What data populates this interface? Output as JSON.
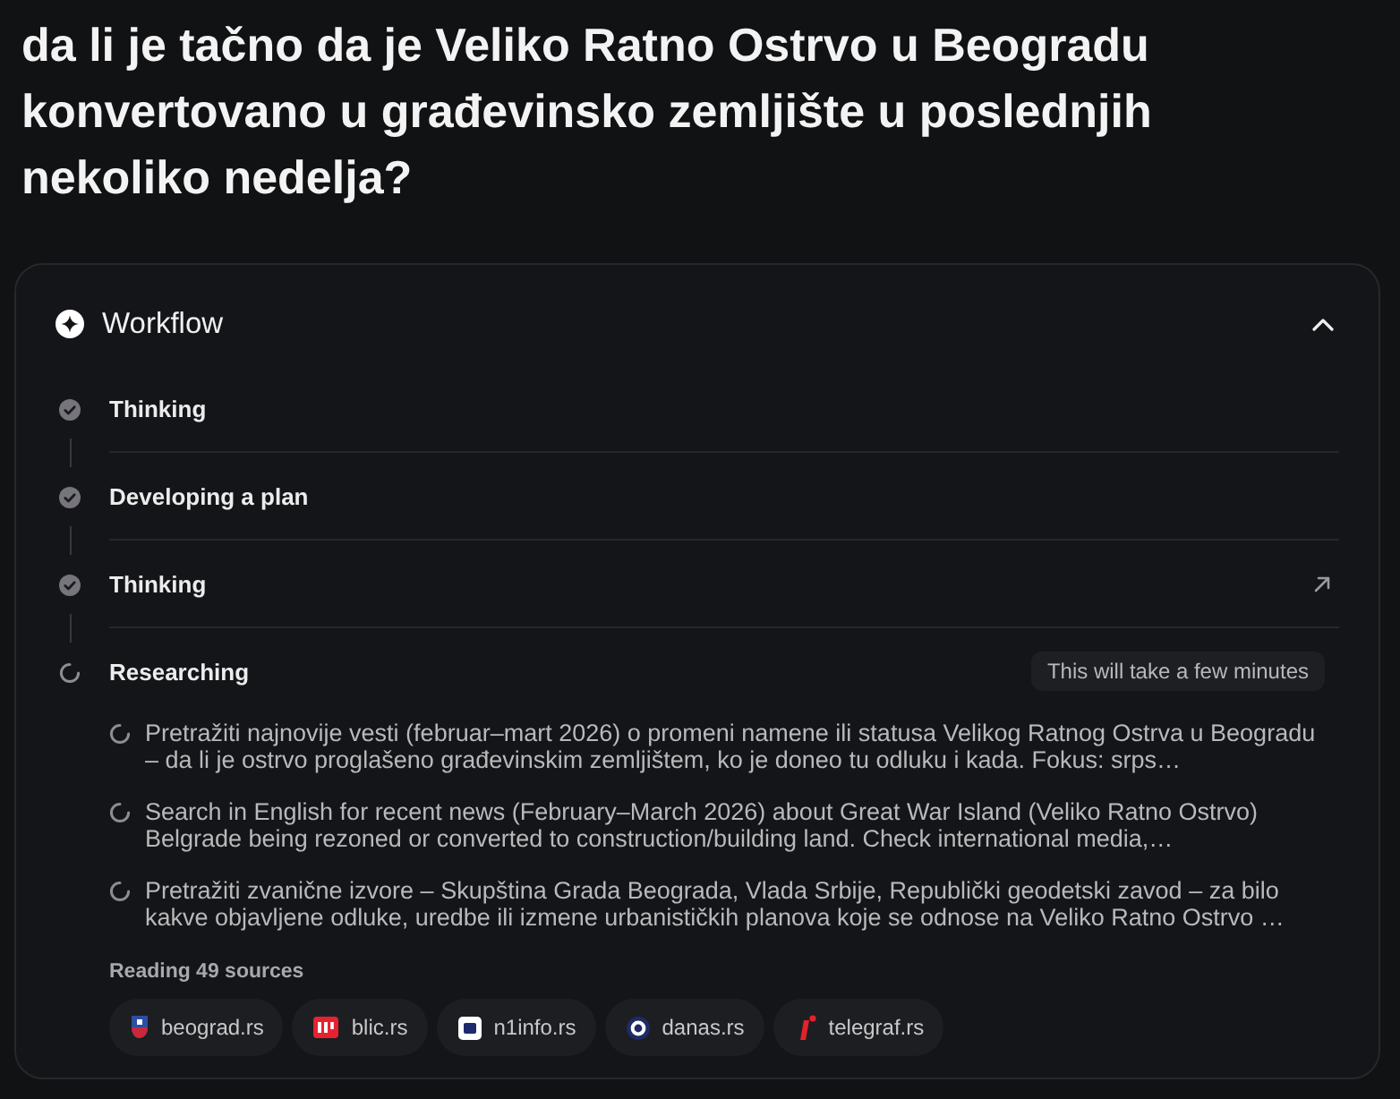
{
  "question": "da li je tačno da je Veliko Ratno Ostrvo u Beogradu konvertovano u građevinsko zemljište u poslednjih nekoliko nedelja?",
  "workflow": {
    "title": "Workflow",
    "expanded": true,
    "steps": [
      {
        "label": "Thinking",
        "done": true,
        "link": false
      },
      {
        "label": "Developing a plan",
        "done": true,
        "link": false
      },
      {
        "label": "Thinking",
        "done": true,
        "link": true
      },
      {
        "label": "Researching",
        "done": false,
        "link": false,
        "note": "This will take a few minutes",
        "tasks": [
          {
            "text": "Pretražiti najnovije vesti (februar–mart 2026) o promeni namene ili statusa Velikog Ratnog Ostrva u Beogradu – da li je ostrvo proglašeno građevinskim zemljištem, ko je doneo tu odluku i kada. Fokus: srps…",
            "done": false
          },
          {
            "text": "Search in English for recent news (February–March 2026) about Great War Island (Veliko Ratno Ostrvo) Belgrade being rezoned or converted to construction/building land. Check international media,…",
            "done": false
          },
          {
            "text": "Pretražiti zvanične izvore – Skupština Grada Beograda, Vlada Srbije, Republički geodetski zavod – za bilo kakve objavljene odluke, uredbe ili izmene urbanističkih planova koje se odnose na Veliko Ratno Ostrvo …",
            "done": false
          }
        ],
        "sources_label": "Reading 49 sources",
        "sources": [
          {
            "name": "beograd.rs",
            "kind": "crest"
          },
          {
            "name": "blic.rs",
            "kind": "block"
          },
          {
            "name": "n1info.rs",
            "kind": "square"
          },
          {
            "name": "danas.rs",
            "kind": "ring"
          },
          {
            "name": "telegraf.rs",
            "kind": "slash"
          }
        ]
      }
    ]
  }
}
